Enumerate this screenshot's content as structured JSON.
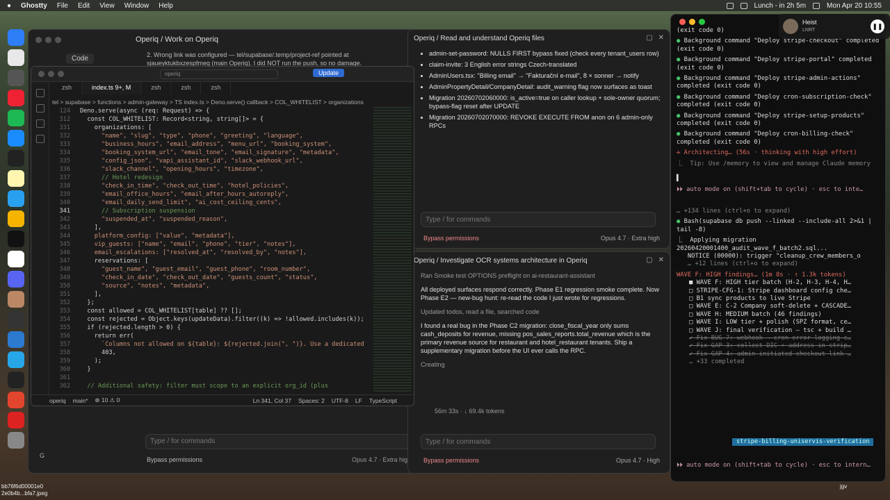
{
  "menubar": {
    "app": "Ghostty",
    "items": [
      "File",
      "Edit",
      "View",
      "Window",
      "Help"
    ],
    "status": "Lunch - in 2h 5m",
    "datetime": "Mon Apr 20  10:55"
  },
  "now_playing": {
    "title": "Heist",
    "subtitle": "LNRT"
  },
  "desktop": {
    "file_label_1": "bb76f6d00001e0",
    "file_label_2": "2e0b4b...bfa7.jpeg",
    "corner": "jgv"
  },
  "left": {
    "title": "Operiq / Work on Operiq",
    "code_tab": "Code",
    "msg_line1": "2. Wrong link was configured — tel/supabase/.temp/project-ref pointed at",
    "msg_line2": "sjaueyktukbxzespfmeg (main Operiq). I did NOT run the push, so no damage.",
    "input_placeholder": "Type / for commands",
    "perm": "Bypass permissions",
    "model": "Opus 4.7 · Extra high",
    "g": "G"
  },
  "vscode": {
    "search": "operiq",
    "update": "Update",
    "tabs": [
      "zsh",
      "index.ts 9+, M",
      "zsh",
      "zsh",
      "zsh"
    ],
    "breadcrumb": "tel > supabase > functions > admin-gateway > TS index.ts > Deno.serve() callback > COL_WHITELIST > organizations",
    "lines": [
      [
        "124",
        "Deno.serve(async (req: Request) => {"
      ],
      [
        "312",
        "  const COL_WHITELIST: Record<string, string[]> = {"
      ],
      [
        "331",
        "    organizations: ["
      ],
      [
        "332",
        "      \"name\", \"slug\", \"type\", \"phone\", \"greeting\", \"language\","
      ],
      [
        "333",
        "      \"business_hours\", \"email_address\", \"menu_url\", \"booking_system\","
      ],
      [
        "334",
        "      \"booking_system_url\", \"email_tone\", \"email_signature\", \"metadata\","
      ],
      [
        "335",
        "      \"config_json\", \"vapi_assistant_id\", \"slack_webhook_url\","
      ],
      [
        "336",
        "      \"slack_channel\", \"opening_hours\", \"timezone\","
      ],
      [
        "337",
        "      // Hotel redesign"
      ],
      [
        "338",
        "      \"check_in_time\", \"check_out_time\", \"hotel_policies\","
      ],
      [
        "339",
        "      \"email_office_hours\", \"email_after_hours_autoreply\","
      ],
      [
        "340",
        "      \"email_daily_send_limit\", \"ai_cost_ceiling_cents\","
      ],
      [
        "341",
        "      // Subscription suspension"
      ],
      [
        "342",
        "      \"suspended_at\", \"suspended_reason\","
      ],
      [
        "343",
        "    ],"
      ],
      [
        "344",
        "    platform_config: [\"value\", \"metadata\"],"
      ],
      [
        "345",
        "    vip_guests: [\"name\", \"email\", \"phone\", \"tier\", \"notes\"],"
      ],
      [
        "346",
        "    email_escalations: [\"resolved_at\", \"resolved_by\", \"notes\"],"
      ],
      [
        "347",
        "    reservations: ["
      ],
      [
        "348",
        "      \"guest_name\", \"guest_email\", \"guest_phone\", \"room_number\","
      ],
      [
        "349",
        "      \"check_in_date\", \"check_out_date\", \"guests_count\", \"status\","
      ],
      [
        "350",
        "      \"source\", \"notes\", \"metadata\","
      ],
      [
        "351",
        "    ],"
      ],
      [
        "352",
        "  };"
      ],
      [
        "353",
        "  const allowed = COL_WHITELIST[table] ?? [];"
      ],
      [
        "354",
        "  const rejected = Object.keys(updateData).filter((k) => !allowed.includes(k));"
      ],
      [
        "355",
        "  if (rejected.length > 0) {"
      ],
      [
        "356",
        "    return err("
      ],
      [
        "357",
        "      `Columns not allowed on ${table}: ${rejected.join(\", \")}. Use a dedicated"
      ],
      [
        "358",
        "      403,"
      ],
      [
        "359",
        "    );"
      ],
      [
        "360",
        "  }"
      ],
      [
        "361",
        ""
      ],
      [
        "362",
        "  // Additional safety: filter must scope to an explicit org_id (plus"
      ]
    ],
    "status": {
      "branch": "main*",
      "problems": "⊗ 10 ⚠ 0",
      "cursor": "Ln 341, Col 37",
      "spaces": "Spaces: 2",
      "enc": "UTF-8",
      "eol": "LF",
      "lang": "TypeScript",
      "repo": "operiq"
    }
  },
  "mid1": {
    "title": "Operiq / Read and understand Operiq files",
    "items": [
      "admin-set-password: NULLS FIRST bypass fixed (check every tenant_users row)",
      "claim-invite: 3 English error strings Czech-translated",
      "AdminUsers.tsx: \"Billing email\" → \"Fakturační e-mail\", 8 × sonner → notify",
      "AdminPropertyDetail/CompanyDetail: audit_warning flag now surfaces as toast",
      "Migration 20260702060000: is_active=true on caller lookup + sole-owner quorum; bypass-flag reset after UPDATE",
      "Migration 20260702070000: REVOKE EXECUTE FROM anon on 6 admin-only RPCs"
    ],
    "input": "Type / for commands",
    "perm": "Bypass permissions",
    "model": "Opus 4.7 · Extra high"
  },
  "mid2": {
    "title": "Operiq / Investigate OCR systems architecture in Operiq",
    "ran": "Ran Smoke test OPTIONS preflight on ai-restaurant-assistant",
    "p1": "All deployed surfaces respond correctly. Phase E1 regression smoke complete. Now Phase E2 — new-bug hunt: re-read the code I just wrote for regressions.",
    "updated": "Updated todos, read a file, searched code",
    "p2": "I found a real bug in the Phase C2 migration: close_fiscal_year only sums cash_deposits for revenue, missing pos_sales_reports.total_revenue which is the primary revenue source for restaurant and hotel_restaurant tenants. Ship a supplementary migration before the UI ever calls the RPC.",
    "creating": "Creating",
    "tokens": "56m 33s · ↓ 69.4k tokens",
    "input": "Type / for commands",
    "perm": "Bypass permissions",
    "model": "Opus 4.7 · High"
  },
  "term": {
    "top": "(exit code 0)",
    "deploys": [
      "Background command \"Deploy stripe-checkout\" completed (exit code 0)",
      "Background command \"Deploy stripe-portal\" completed (exit code 0)",
      "Background command \"Deploy stripe-admin-actions\" completed (exit code 0)",
      "Background command \"Deploy cron-subscription-check\" completed (exit code 0)",
      "Background command \"Deploy stripe-setup-products\" completed (exit code 0)",
      "Background command \"Deploy cron-billing-check\" completed (exit code 0)"
    ],
    "arch": "✢ Architecting… (56s · thinking with high effort)",
    "tip": "⎿  Tip: Use /memory to view and manage Claude memory",
    "auto1": "⏵⏵ auto mode on (shift+tab to cycle) · esc to inte…",
    "hidden": "… +134 lines (ctrl+o to expand)",
    "bash": "Bash(supabase db push --linked --include-all 2>&1 | tail -8)",
    "apply": "⎿  Applying migration 20260420001400_audit_wave_f_batch2.sql...",
    "notice": "   NOTICE (00000): trigger \"cleanup_crew_members_o",
    "more": "   … +12 lines (ctrl+o to expand)",
    "wave": "WAVE F: HIGH findings… (1m 8s · ↑ 1.3k tokens)",
    "todos": [
      "■ WAVE F: HIGH tier batch (H-2, H-3, H-4, H…",
      "□ STRIPE-CFG-1: Stripe dashboard config che…",
      "□ B1 sync products to live Stripe",
      "□ WAVE E: C-2 Company soft-delete + CASCADE…",
      "□ WAVE H: MEDIUM batch (46 findings)",
      "□ WAVE I: LOW tier + polish (SPZ format, ce…",
      "□ WAVE J: final verification — tsc + build …"
    ],
    "done": [
      "✔ Fix BUG-7: webhook → cron error logging c…",
      "✔ Fix GAP-3: collect DIC + address in strip…",
      "✔ Fix GAP-4: admin-initiated checkout link …"
    ],
    "completed": "… +33 completed",
    "tag": "stripe-billing-uniservis-verification",
    "auto2": "⏵⏵ auto mode on (shift+tab to cycle) · esc to intern…"
  }
}
